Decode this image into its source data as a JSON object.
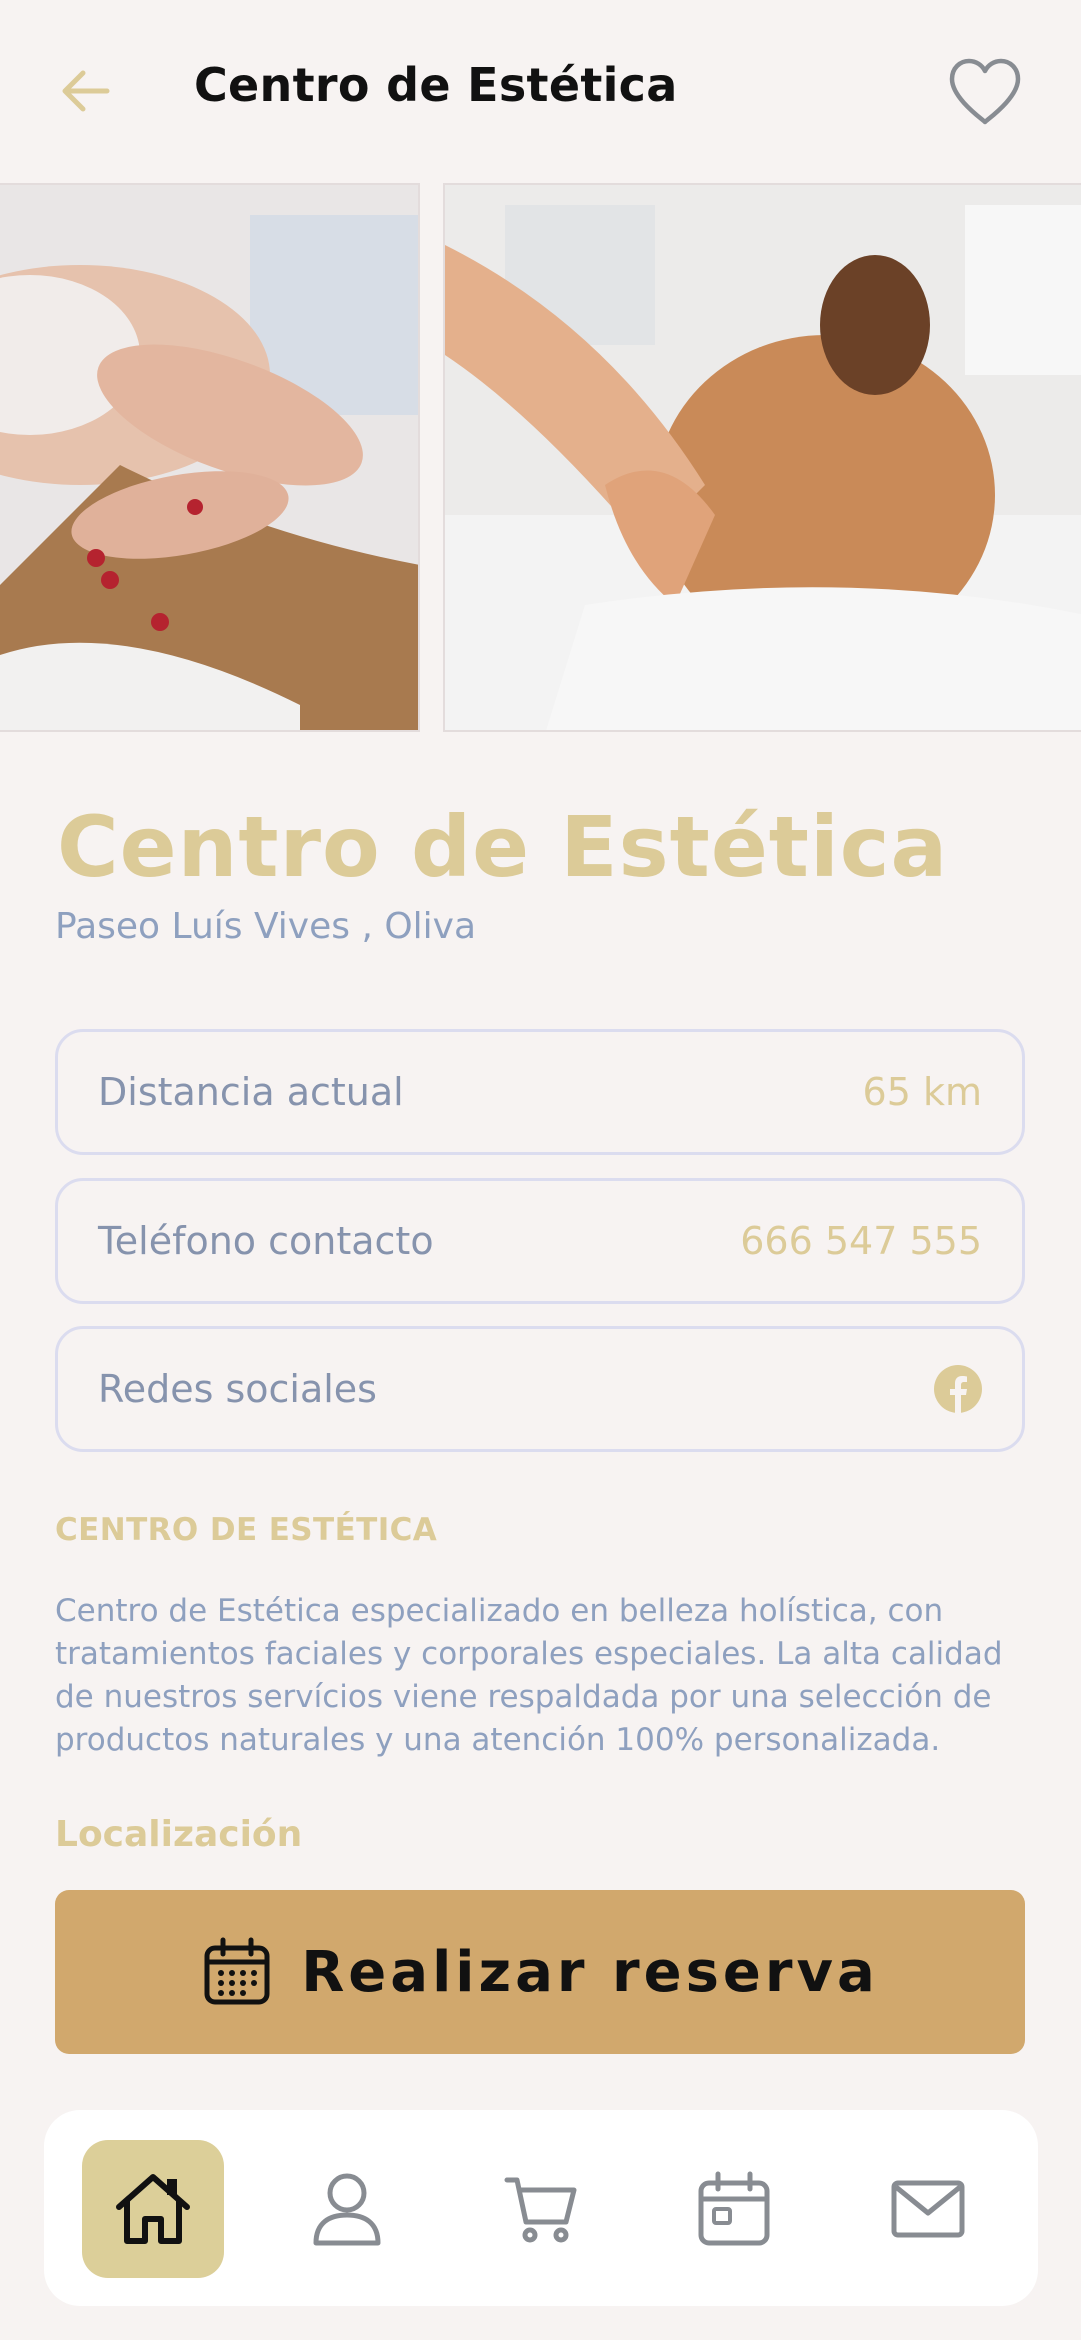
{
  "header": {
    "title": "Centro de Estética"
  },
  "gallery": {
    "photos": [
      "facial-treatment-photo",
      "back-massage-photo"
    ]
  },
  "venue": {
    "name": "Centro de Estética",
    "address": "Paseo Luís Vives , Oliva"
  },
  "info": {
    "distance_label": "Distancia actual",
    "distance_value": "65 km",
    "phone_label": "Teléfono contacto",
    "phone_value": "666 547 555",
    "social_label": "Redes sociales",
    "social_icon": "facebook-icon"
  },
  "about": {
    "heading": "CENTRO DE ESTÉTICA",
    "text": "Centro de Estética  especializado  en belleza holística, con tratamientos faciales y corporales especiales. La alta calidad de nuestros servícios viene respaldada por una selección de productos naturales y una atención 100% personalizada."
  },
  "location": {
    "heading": "Localización"
  },
  "reserve": {
    "label": "Realizar reserva",
    "icon": "calendar-icon"
  },
  "nav": {
    "items": [
      {
        "icon": "home-icon",
        "active": true
      },
      {
        "icon": "user-icon",
        "active": false
      },
      {
        "icon": "cart-icon",
        "active": false
      },
      {
        "icon": "calendar-icon",
        "active": false
      },
      {
        "icon": "mail-icon",
        "active": false
      }
    ]
  },
  "colors": {
    "background": "#f7f3f2",
    "accent_gold": "#dccb98",
    "button_gold": "#d1a86d",
    "muted_blue": "#8ea0bf",
    "nav_active": "#dccf99"
  }
}
